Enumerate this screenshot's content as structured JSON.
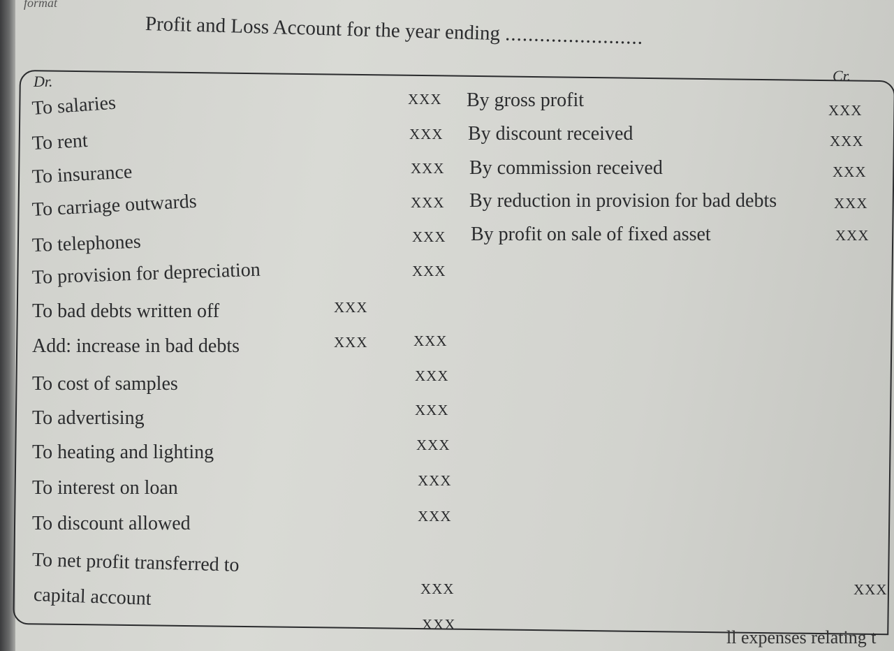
{
  "header": {
    "top_fragment": "format",
    "title": "Profit and Loss Account for the year ending",
    "title_dots": "........................"
  },
  "columns": {
    "debit": "Dr.",
    "credit": "Cr."
  },
  "debit_items": [
    {
      "label": "To salaries",
      "amount": "XXX"
    },
    {
      "label": "To rent",
      "amount": "XXX"
    },
    {
      "label": "To insurance",
      "amount": "XXX"
    },
    {
      "label": "To carriage outwards",
      "amount": "XXX"
    },
    {
      "label": "To telephones",
      "amount": "XXX"
    },
    {
      "label": "To provision for depreciation",
      "amount": "XXX"
    },
    {
      "label": "To bad debts written off",
      "sub_amount": "XXX"
    },
    {
      "label": "Add: increase in bad debts",
      "sub_amount": "XXX",
      "amount": "XXX"
    },
    {
      "label": "To cost of samples",
      "amount": "XXX"
    },
    {
      "label": "To advertising",
      "amount": "XXX"
    },
    {
      "label": "To heating and lighting",
      "amount": "XXX"
    },
    {
      "label": "To interest on loan",
      "amount": "XXX"
    },
    {
      "label": "To discount allowed",
      "amount": "XXX"
    },
    {
      "label": "To net profit transferred to",
      "label_cont": "capital account",
      "amount": "XXX"
    }
  ],
  "credit_items": [
    {
      "label": "By gross profit",
      "amount": "XXX"
    },
    {
      "label": "By discount received",
      "amount": "XXX"
    },
    {
      "label": "By commission received",
      "amount": "XXX"
    },
    {
      "label": "By reduction in provision for  bad debts",
      "amount": "XXX"
    },
    {
      "label": "By profit on sale of fixed asset",
      "amount": "XXX"
    }
  ],
  "totals": {
    "debit": "XXX",
    "credit": "XXX"
  },
  "footer": {
    "fragment": "ll expenses relating t"
  }
}
